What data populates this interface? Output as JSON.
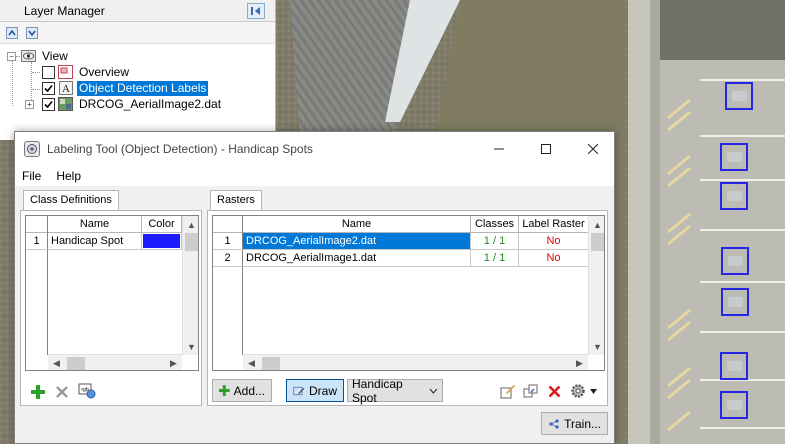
{
  "layer_manager": {
    "title": "Layer Manager",
    "tree": [
      {
        "label": "View",
        "checked": null
      },
      {
        "label": "Overview",
        "checked": false
      },
      {
        "label": "Object Detection Labels",
        "checked": true,
        "selected": true
      },
      {
        "label": "DRCOG_AerialImage2.dat",
        "checked": true
      }
    ]
  },
  "dialog": {
    "title": "Labeling Tool (Object Detection) - Handicap Spots",
    "menu": [
      "File",
      "Help"
    ],
    "class_definitions": {
      "tab_label": "Class Definitions",
      "columns": [
        "Name",
        "Color"
      ],
      "rows": [
        {
          "num": "1",
          "name": "Handicap Spot",
          "color": "#1c1cff"
        }
      ]
    },
    "rasters": {
      "tab_label": "Rasters",
      "columns": [
        "Name",
        "Classes",
        "Label Raster"
      ],
      "rows": [
        {
          "num": "1",
          "name": "DRCOG_AerialImage2.dat",
          "classes": "1 / 1",
          "label_raster": "No"
        },
        {
          "num": "2",
          "name": "DRCOG_AerialImage1.dat",
          "classes": "1 / 1",
          "label_raster": "No"
        }
      ]
    },
    "buttons": {
      "add": "Add...",
      "draw": "Draw",
      "class_select": "Handicap Spot",
      "train": "Train..."
    }
  },
  "colors": {
    "selection": "#0078d7",
    "bbox": "#2626e6",
    "classes_text": "#1a8a1a",
    "label_raster_text": "#e00000"
  }
}
